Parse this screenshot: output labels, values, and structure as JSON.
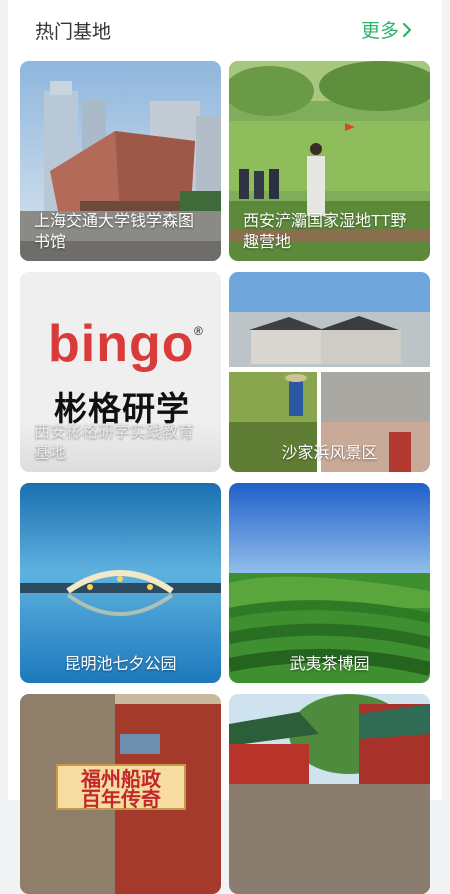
{
  "header": {
    "title": "热门基地",
    "more_label": "更多"
  },
  "cards": [
    {
      "caption": "上海交通大学钱学森图书馆"
    },
    {
      "caption": "西安浐灞国家湿地TT野趣营地"
    },
    {
      "caption": "西安彬格研学实践教育基地",
      "logo_word": "bingo",
      "logo_mark": "®",
      "logo_cn": "彬格研学"
    },
    {
      "caption": "沙家浜风景区"
    },
    {
      "caption": "昆明池七夕公园"
    },
    {
      "caption": "武夷茶博园"
    },
    {
      "caption": "",
      "sign_line1": "福州船政",
      "sign_line2": "百年传奇"
    },
    {
      "caption": ""
    }
  ],
  "colors": {
    "accent": "#2fb36b",
    "title_text": "#333333"
  }
}
